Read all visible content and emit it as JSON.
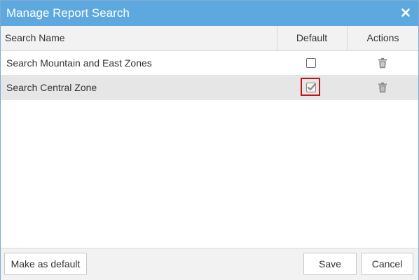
{
  "dialog": {
    "title": "Manage Report Search",
    "close_icon": "close-icon"
  },
  "grid": {
    "columns": {
      "name": "Search Name",
      "default": "Default",
      "actions": "Actions"
    },
    "rows": [
      {
        "name": "Search Mountain and East Zones",
        "default": false,
        "selected": false
      },
      {
        "name": "Search Central Zone",
        "default": true,
        "selected": true
      }
    ]
  },
  "footer": {
    "make_default_label": "Make as default",
    "save_label": "Save",
    "cancel_label": "Cancel"
  },
  "colors": {
    "titlebar": "#5ea8e0",
    "highlight_border": "#c0161b",
    "selected_row": "#e6e6e6"
  }
}
